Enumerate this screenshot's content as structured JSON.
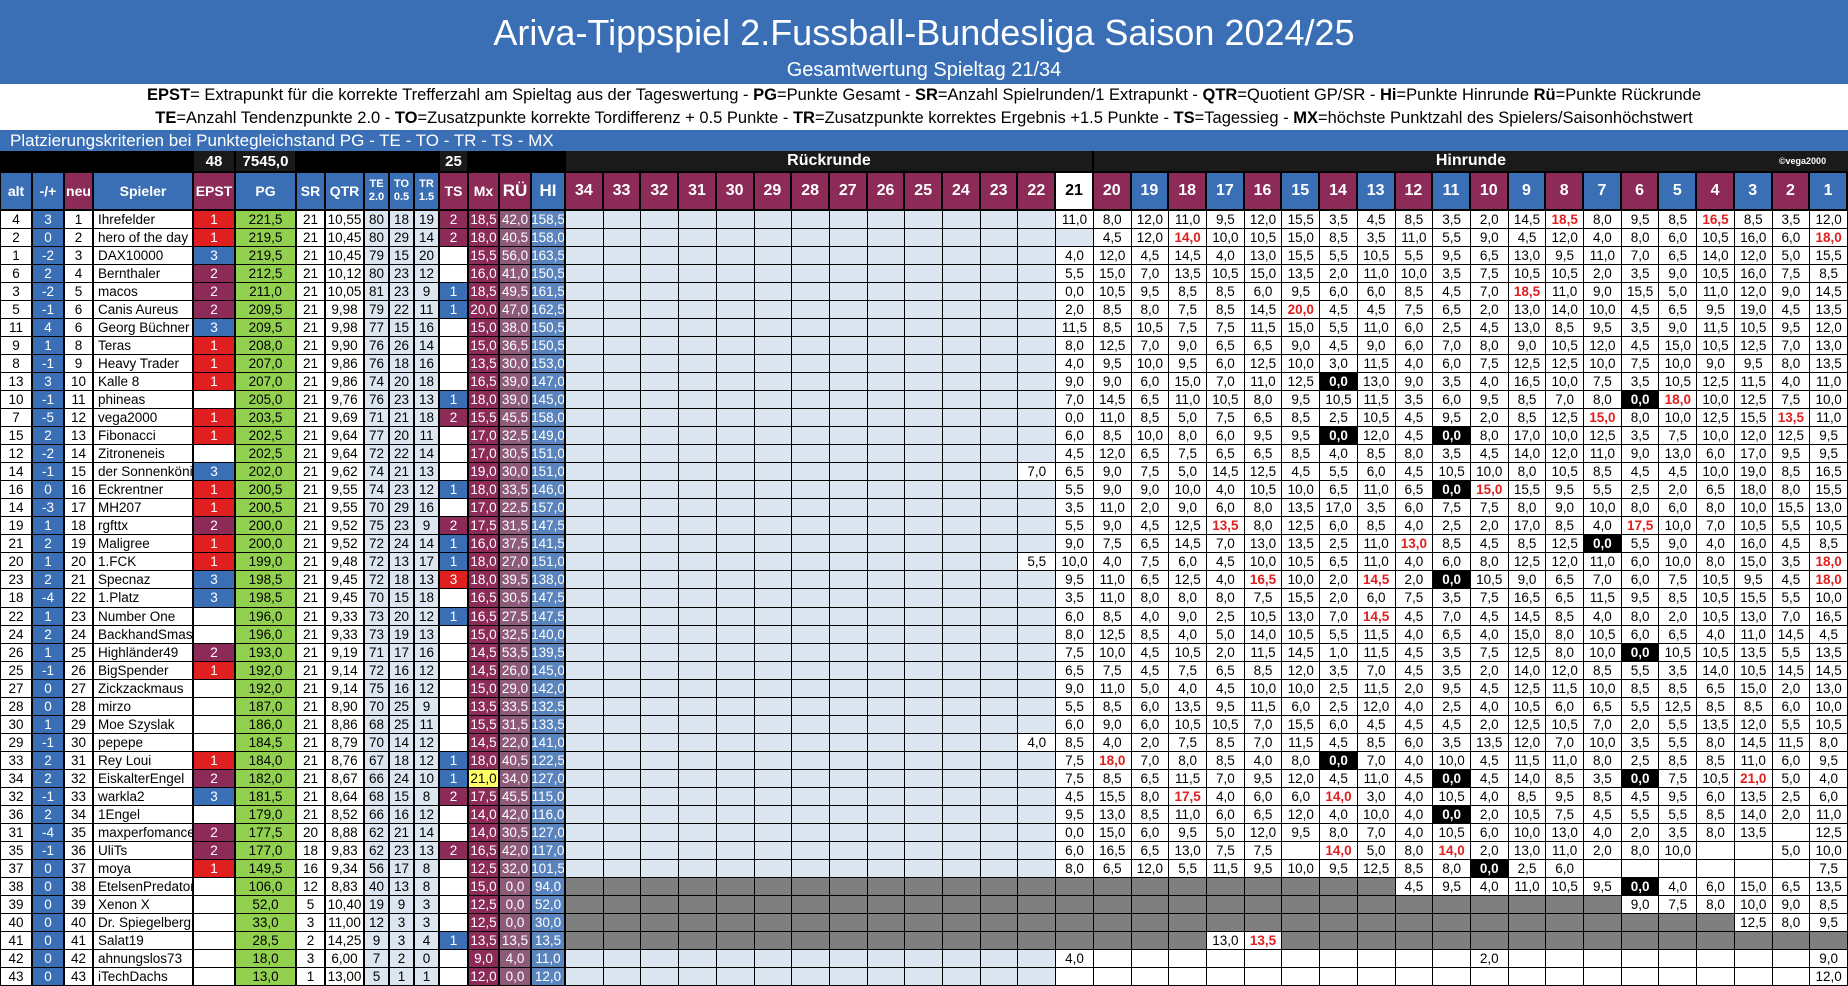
{
  "title": "Ariva-Tippspiel 2.Fussball-Bundesliga Saison 2024/25",
  "subtitle": "Gesamtwertung Spieltag 21/34",
  "legend_line1": [
    {
      "b": "EPST"
    },
    {
      "t": "= Extrapunkt für die korrekte Trefferzahl am Spieltag aus der Tageswertung - "
    },
    {
      "b": "PG"
    },
    {
      "t": "=Punkte Gesamt - "
    },
    {
      "b": "SR"
    },
    {
      "t": "=Anzahl Spielrunden/1 Extrapunkt - "
    },
    {
      "b": "QTR"
    },
    {
      "t": "=Quotient GP/SR - "
    },
    {
      "b": "Hi"
    },
    {
      "t": "=Punkte Hinrunde  "
    },
    {
      "b": "Rü"
    },
    {
      "t": "=Punkte Rückrunde"
    }
  ],
  "legend_line2": [
    {
      "b": "TE"
    },
    {
      "t": "=Anzahl Tendenzpunkte 2.0 - "
    },
    {
      "b": "TO"
    },
    {
      "t": "=Zusatzpunkte korrekte Tordifferenz + 0.5 Punkte - "
    },
    {
      "b": "TR"
    },
    {
      "t": "=Zusatzpunkte korrektes Ergebnis +1.5 Punkte - "
    },
    {
      "b": "TS"
    },
    {
      "t": "=Tagessieg - "
    },
    {
      "b": "MX"
    },
    {
      "t": "=höchste Punktzahl des Spielers/Saisonhöchstwert"
    }
  ],
  "criteria": "Platzierungskriterien bei Punktegleichstand  PG - TE - TO - TR - TS - MX",
  "totals": {
    "epst": "48",
    "pg": "7545,0",
    "ts": "25"
  },
  "section_rueckrunde": "Rückrunde",
  "section_hinrunde": "Hinrunde",
  "credit": "©vega2000",
  "headers": {
    "alt": "alt",
    "move": "-/+",
    "neu": "neu",
    "spieler": "Spieler",
    "epst": "EPST",
    "pg": "PG",
    "sr": "SR",
    "qtr": "QTR",
    "te": "TE",
    "te_sub": "2.0",
    "to": "TO",
    "to_sub": "0.5",
    "tr": "TR",
    "tr_sub": "1.5",
    "ts": "TS",
    "mx": "Mx",
    "ru": "RÜ",
    "hi": "HI"
  },
  "matchdays": [
    "34",
    "33",
    "32",
    "31",
    "30",
    "29",
    "28",
    "27",
    "26",
    "25",
    "24",
    "23",
    "22",
    "21",
    "20",
    "19",
    "18",
    "17",
    "16",
    "15",
    "14",
    "13",
    "12",
    "11",
    "10",
    "9",
    "8",
    "7",
    "6",
    "5",
    "4",
    "3",
    "2",
    "1"
  ],
  "colors": {
    "header_blue": "#3a6fb5",
    "maroon": "#8c2a58",
    "epst_red": "#e02020",
    "epst_purple": "#8c2a58",
    "epst_blue": "#3a6fb5",
    "pg_green": "#92d050",
    "mx_yellow": "#ffff66",
    "highlight_red": "#e02020",
    "zero_bg": "#000000",
    "empty_blue": "#dce6f1",
    "inactive_gray": "#7f7f7f"
  },
  "rows": [
    [
      "4",
      "3",
      "1",
      "Ihrefelder",
      "1",
      "221,5",
      "21",
      "10,55",
      "80",
      "18",
      "19",
      "2",
      "18,5",
      "42,0",
      "158,5",
      "11,0 8,0 12,0 11,0 9,5 12,0 15,5 3,5 4,5 8,5 3,5 2,0 14,5 18,5r 8,0 9,5 8,5 16,5r 8,5 3,5 12,0"
    ],
    [
      "2",
      "0",
      "2",
      "hero_of_the_day",
      "1",
      "219,5",
      "21",
      "10,45",
      "80",
      "29",
      "14",
      "2",
      "18,0",
      "40,5",
      "158,0",
      "4,5 12,0 14,0r 10,0 10,5 15,0 8,5 3,5 11,0 5,5 9,0 4,5 12,0 4,0 8,0 6,0 10,5 16,0 6,0 18,0r"
    ],
    [
      "1",
      "-2",
      "3",
      "DAX10000",
      "3",
      "219,5",
      "21",
      "10,45",
      "79",
      "15",
      "20",
      "",
      "15,5",
      "56,0",
      "163,5",
      "4,0 12,0 4,5 14,5 4,0 13,0 15,5 5,5 10,5 5,5 9,5 6,5 13,0 9,5 11,0 7,0 6,5 14,0 12,0 5,0 15,5"
    ],
    [
      "6",
      "2",
      "4",
      "Bernthaler",
      "2",
      "212,5",
      "21",
      "10,12",
      "80",
      "23",
      "12",
      "",
      "16,0",
      "41,0",
      "150,5",
      "5,5 15,0 7,0 13,5 10,5 15,0 13,5 2,0 11,0 10,0 3,5 7,5 10,5 10,5 2,0 3,5 9,0 10,5 16,0 7,5 8,5"
    ],
    [
      "3",
      "-2",
      "5",
      "macos",
      "2",
      "211,0",
      "21",
      "10,05",
      "81",
      "23",
      "9",
      "1",
      "18,5",
      "49,5",
      "161,5",
      "0,0 10,5 9,5 8,5 8,5 6,0 9,5 6,0 6,0 8,5 4,5 7,0 18,5r 11,0 9,0 15,5 5,0 11,0 12,0 9,0 14,5"
    ],
    [
      "5",
      "-1",
      "6",
      "Canis_Aureus",
      "2",
      "209,5",
      "21",
      "9,98",
      "79",
      "22",
      "11",
      "1",
      "20,0",
      "47,0",
      "162,5",
      "2,0 8,5 8,0 7,5 8,5 14,5 20,0r 4,5 4,5 7,5 6,5 2,0 13,0 14,0 10,0 4,5 6,5 9,5 19,0 4,5 13,5"
    ],
    [
      "11",
      "4",
      "6",
      "Georg_Büchner",
      "3",
      "209,5",
      "21",
      "9,98",
      "77",
      "15",
      "16",
      "",
      "15,0",
      "38,0",
      "150,5",
      "11,5 8,5 10,5 7,5 7,5 11,5 15,0 5,5 11,0 6,0 2,5 4,5 13,0 8,5 9,5 3,5 9,0 11,5 10,5 9,5 12,0"
    ],
    [
      "9",
      "1",
      "8",
      "Teras",
      "1",
      "208,0",
      "21",
      "9,90",
      "76",
      "26",
      "14",
      "",
      "15,0",
      "36,5",
      "150,5",
      "8,0 12,5 7,0 9,0 6,5 6,5 9,0 4,5 9,0 6,0 7,0 8,0 9,0 10,5 12,0 4,5 15,0 10,5 12,5 7,0 13,0"
    ],
    [
      "8",
      "-1",
      "9",
      "Heavy_Trader",
      "1",
      "207,0",
      "21",
      "9,86",
      "76",
      "18",
      "16",
      "",
      "13,5",
      "30,0",
      "153,0",
      "4,0 9,5 10,0 9,5 6,0 12,5 10,0 3,0 11,5 4,0 6,0 7,5 12,5 12,5 10,0 7,5 10,0 9,0 9,5 8,0 13,5"
    ],
    [
      "13",
      "3",
      "10",
      "Kalle_8",
      "1",
      "207,0",
      "21",
      "9,86",
      "74",
      "20",
      "18",
      "",
      "16,5",
      "39,0",
      "147,0",
      "9,0 9,0 6,0 15,0 7,0 11,0 12,5 0,0z 13,0 9,0 3,5 4,0 16,5 10,0 7,5 3,5 10,5 12,5 11,5 4,0 11,0"
    ],
    [
      "10",
      "-1",
      "11",
      "phineas",
      "",
      "205,0",
      "21",
      "9,76",
      "76",
      "23",
      "13",
      "1",
      "18,0",
      "39,0",
      "145,0",
      "7,0 14,5 6,5 11,0 10,5 8,0 9,5 10,5 11,5 3,5 6,0 9,5 8,5 7,0 8,0 0,0z 18,0r 10,0 12,5 7,5 10,0"
    ],
    [
      "7",
      "-5",
      "12",
      "vega2000",
      "1",
      "203,5",
      "21",
      "9,69",
      "71",
      "21",
      "18",
      "2",
      "15,5",
      "45,5",
      "158,0",
      "0,0 11,0 8,5 5,0 7,5 6,5 8,5 2,5 10,5 4,5 9,5 2,0 8,5 12,5 15,0r 8,0 10,0 12,5 15,5 13,5r 11,0"
    ],
    [
      "15",
      "2",
      "13",
      "Fibonacci",
      "1",
      "202,5",
      "21",
      "9,64",
      "77",
      "20",
      "11",
      "",
      "17,0",
      "32,5",
      "149,0",
      "6,0 8,5 10,0 8,0 6,0 9,5 9,5 0,0z 12,0 4,5 0,0z 8,0 17,0 10,0 12,5 3,5 7,5 10,0 12,0 12,5 9,5"
    ],
    [
      "12",
      "-2",
      "14",
      "Zitroneneis",
      "",
      "202,5",
      "21",
      "9,64",
      "72",
      "22",
      "14",
      "",
      "17,0",
      "30,5",
      "151,0",
      "4,5 12,0 6,5 7,5 6,5 6,5 8,5 4,0 8,5 8,0 3,5 4,5 14,0 12,0 11,0 9,0 13,0 6,0 17,0 9,5 9,5"
    ],
    [
      "14",
      "-1",
      "15",
      "der_Sonnenkönig",
      "3",
      "202,0",
      "21",
      "9,62",
      "74",
      "21",
      "13",
      "",
      "19,0",
      "30,0",
      "151,0",
      "7,0 6,5 9,0 7,5 5,0 14,5 12,5 4,5 5,5 6,0 4,5 10,5 10,0 8,0 10,5 8,5 4,5 4,5 10,0 19,0 8,5 16,5"
    ],
    [
      "16",
      "0",
      "16",
      "Eckrentner",
      "1",
      "200,5",
      "21",
      "9,55",
      "74",
      "23",
      "12",
      "1",
      "18,0",
      "33,5",
      "146,0",
      "5,5 9,0 9,0 10,0 4,0 10,5 10,0 6,5 11,0 6,5 0,0z 15,0r 15,5 9,5 5,5 2,5 2,0 6,5 18,0 8,0 15,5"
    ],
    [
      "14",
      "-3",
      "17",
      "MH207",
      "1",
      "200,5",
      "21",
      "9,55",
      "70",
      "29",
      "16",
      "",
      "17,0",
      "22,5",
      "157,0",
      "3,5 11,0 2,0 9,0 6,0 8,0 13,5 17,0 3,5 6,0 7,5 7,5 8,0 9,0 10,0 8,0 6,0 8,0 10,0 15,5 13,0"
    ],
    [
      "19",
      "1",
      "18",
      "rgfttx",
      "2",
      "200,0",
      "21",
      "9,52",
      "75",
      "23",
      "9",
      "2",
      "17,5",
      "31,5",
      "147,5",
      "5,5 9,0 4,5 12,5 13,5r 8,0 12,5 6,0 8,5 4,0 2,5 2,0 17,0 8,5 4,0 17,5r 10,0 7,0 10,5 5,5 10,5"
    ],
    [
      "21",
      "2",
      "19",
      "Maligree",
      "1",
      "200,0",
      "21",
      "9,52",
      "72",
      "24",
      "14",
      "1",
      "16,0",
      "37,5",
      "141,5",
      "9,0 7,5 6,5 14,5 7,0 13,0 13,5 2,5 11,0 13,0r 8,5 4,5 8,5 12,5 0,0z 5,5 9,0 4,0 16,0 4,5 8,5"
    ],
    [
      "20",
      "1",
      "20",
      "1.FCK",
      "1",
      "199,0",
      "21",
      "9,48",
      "72",
      "13",
      "17",
      "1",
      "18,0",
      "27,0",
      "151,0",
      "5,5 10,0 4,0 7,5 6,0 4,5 10,0 10,5 6,5 11,0 4,0 6,0 8,0 12,5 12,0 11,0 6,0 10,0 8,0 15,0 3,5 18,0r"
    ],
    [
      "23",
      "2",
      "21",
      "Specnaz",
      "3",
      "198,5",
      "21",
      "9,45",
      "72",
      "18",
      "13",
      "3",
      "18,0",
      "39,5",
      "138,0",
      "9,5 11,0 6,5 12,5 4,0 16,5r 10,0 2,0 14,5r 2,0 0,0z 10,5 9,0 6,5 7,0 6,0 7,5 10,5 9,5 4,5 18,0r"
    ],
    [
      "18",
      "-4",
      "22",
      "1.Platz",
      "3",
      "198,5",
      "21",
      "9,45",
      "70",
      "15",
      "18",
      "",
      "16,5",
      "30,5",
      "147,5",
      "3,5 11,0 8,0 8,0 8,0 7,5 15,5 2,0 6,0 7,5 3,5 7,5 16,5 6,5 11,5 9,5 8,5 10,5 15,5 5,5 10,0"
    ],
    [
      "22",
      "1",
      "23",
      "Number_One",
      "",
      "196,0",
      "21",
      "9,33",
      "73",
      "20",
      "12",
      "1",
      "16,5",
      "27,5",
      "147,5",
      "6,0 8,5 4,0 9,0 2,5 10,5 13,0 7,0 14,5r 4,5 7,0 4,5 14,5 8,5 4,0 8,0 2,0 10,5 13,0 7,0 16,5"
    ],
    [
      "24",
      "2",
      "24",
      "BackhandSmash",
      "",
      "196,0",
      "21",
      "9,33",
      "73",
      "19",
      "13",
      "",
      "15,0",
      "32,5",
      "140,0",
      "8,0 12,5 8,5 4,0 5,0 14,0 10,5 5,5 11,5 4,0 6,5 4,0 15,0 8,0 10,5 6,0 6,5 4,0 11,0 14,5 4,5"
    ],
    [
      "26",
      "1",
      "25",
      "Highländer49",
      "2",
      "193,0",
      "21",
      "9,19",
      "71",
      "17",
      "16",
      "",
      "14,5",
      "53,5",
      "139,5",
      "7,5 10,0 4,5 10,5 2,0 11,5 14,5 1,0 11,5 4,5 3,5 7,5 12,5 8,0 10,0 0,0z 10,5 10,5 13,5 5,5 13,5"
    ],
    [
      "25",
      "-1",
      "26",
      "BigSpender",
      "1",
      "192,0",
      "21",
      "9,14",
      "72",
      "16",
      "12",
      "",
      "14,5",
      "26,0",
      "145,0",
      "6,5 7,5 4,5 7,5 6,5 8,5 12,0 3,5 7,0 4,5 3,5 2,0 14,0 12,0 8,5 5,5 3,5 14,0 10,5 14,5 14,5"
    ],
    [
      "27",
      "0",
      "27",
      "Zickzackmaus",
      "",
      "192,0",
      "21",
      "9,14",
      "75",
      "16",
      "12",
      "",
      "15,0",
      "29,0",
      "142,0",
      "9,0 11,0 5,0 4,0 4,5 10,0 10,0 2,5 11,5 2,0 9,5 4,5 12,5 11,5 10,0 8,5 8,5 6,5 15,0 2,0 13,0"
    ],
    [
      "28",
      "0",
      "28",
      "mirzo",
      "",
      "187,0",
      "21",
      "8,90",
      "70",
      "25",
      "9",
      "",
      "13,5",
      "33,5",
      "132,5",
      "5,5 8,5 6,0 13,5 9,5 11,5 6,0 2,5 12,0 4,0 2,5 4,0 10,5 6,0 6,5 5,5 12,5 8,5 8,5 6,0 10,0"
    ],
    [
      "30",
      "1",
      "29",
      "Moe_Szyslak",
      "",
      "186,0",
      "21",
      "8,86",
      "68",
      "25",
      "11",
      "",
      "15,5",
      "31,5",
      "133,5",
      "6,0 9,0 6,0 10,5 10,5 7,0 15,5 6,0 4,5 4,5 4,5 2,0 12,5 10,5 7,0 2,0 5,5 13,5 12,0 5,5 10,5"
    ],
    [
      "29",
      "-1",
      "30",
      "pepepe",
      "",
      "184,5",
      "21",
      "8,79",
      "70",
      "14",
      "12",
      "",
      "14,5",
      "22,0",
      "141,0",
      "4,0 8,5 4,0 2,0 7,5 8,5 7,0 11,5 4,5 8,5 6,0 3,5 13,5 12,0 7,0 10,0 3,5 5,5 8,0 14,5 11,5 8,0"
    ],
    [
      "33",
      "2",
      "31",
      "Rey_Loui",
      "1",
      "184,0",
      "21",
      "8,76",
      "67",
      "18",
      "12",
      "1",
      "18,0",
      "40,5",
      "122,5",
      "7,5 18,0r 7,0 8,0 8,5 4,0 8,0 0,0z 7,0 4,0 10,0 4,5 11,5 11,0 8,0 2,5 8,5 8,5 11,0 6,0 9,5"
    ],
    [
      "34",
      "2",
      "32",
      "EiskalterEngel",
      "2",
      "182,0",
      "21",
      "8,67",
      "66",
      "24",
      "10",
      "1",
      "21,0",
      "34,0",
      "127,0",
      "7,5 8,5 6,5 11,5 7,0 9,5 12,0 4,5 11,0 4,5 0,0z 4,5 14,0 8,5 3,5 0,0z 7,5 10,5 21,0r 5,0 4,0"
    ],
    [
      "32",
      "-1",
      "33",
      "warkla2",
      "3",
      "181,5",
      "21",
      "8,64",
      "68",
      "15",
      "8",
      "2",
      "17,5",
      "45,5",
      "115,0",
      "4,5 15,5 8,0 17,5r 4,0 6,0 6,0 14,0r 3,0 4,0 10,5 4,0 8,5 9,5 8,5 4,5 9,5 6,0 13,5 2,5 6,0"
    ],
    [
      "36",
      "2",
      "34",
      "1Engel",
      "",
      "179,0",
      "21",
      "8,52",
      "66",
      "16",
      "12",
      "",
      "14,0",
      "42,0",
      "116,0",
      "9,5 13,0 8,5 11,0 6,0 6,5 12,0 4,0 10,0 4,0 0,0z 2,0 10,5 7,5 4,5 5,5 5,5 8,5 14,0 2,0 11,0"
    ],
    [
      "31",
      "-4",
      "35",
      "maxperfomance",
      "2",
      "177,5",
      "20",
      "8,88",
      "62",
      "21",
      "14",
      "",
      "14,0",
      "30,5",
      "127,0",
      "0,0 15,0 6,0 9,5 5,0 12,0 9,5 8,0 7,0 4,0 10,5 6,0 10,0 13,0 4,0 2,0 3,5 8,0 13,5 _ 12,5"
    ],
    [
      "35",
      "-1",
      "36",
      "UliTs",
      "2",
      "177,0",
      "18",
      "9,83",
      "62",
      "23",
      "13",
      "2",
      "16,5",
      "42,0",
      "117,0",
      "6,0 16,5 6,5 13,0 7,5 7,5 _ 14,0r 5,0 8,0 14,0r 2,0 13,0 11,0 2,0 8,0 10,0 _ _ 5,0 10,0"
    ],
    [
      "37",
      "0",
      "37",
      "moya",
      "1",
      "149,5",
      "16",
      "9,34",
      "56",
      "17",
      "8",
      "",
      "12,5",
      "32,0",
      "101,5",
      "8,0 6,5 12,0 5,5 11,5 9,5 10,0 9,5 12,5 8,5 8,0 0,0z 2,5 6,0 _ _ _ _ _ _ 7,5"
    ],
    [
      "38",
      "0",
      "38",
      "EtelsenPredator",
      "",
      "106,0",
      "12",
      "8,83",
      "40",
      "13",
      "8",
      "",
      "15,0",
      "0,0",
      "94,0",
      "g g g g g g g g g g 4,5 9,5 4,0 11,0 10,5 9,5 0,0z 4,0 6,0 15,0 6,5 13,5"
    ],
    [
      "39",
      "0",
      "39",
      "Xenon_X",
      "",
      "52,0",
      "5",
      "10,40",
      "19",
      "9",
      "3",
      "",
      "12,5",
      "0,0",
      "52,0",
      "g g g g g g g g g g g g g g g g 9,0 7,5 8,0 10,0 9,0 8,5"
    ],
    [
      "40",
      "0",
      "40",
      "Dr._Spiegelberg",
      "",
      "33,0",
      "3",
      "11,00",
      "12",
      "3",
      "3",
      "",
      "12,5",
      "0,0",
      "30,0",
      "g g g g g g g g g g g g g g g g g g 12,5 8,0 9,5"
    ],
    [
      "41",
      "0",
      "41",
      "Salat19",
      "",
      "28,5",
      "2",
      "14,25",
      "9",
      "3",
      "4",
      "1",
      "13,5",
      "13,5",
      "13,5",
      "g g g g 13,0 13,5r g g g g g g g g g g g g g g g"
    ],
    [
      "42",
      "0",
      "42",
      "ahnungslos73",
      "",
      "18,0",
      "3",
      "6,00",
      "7",
      "2",
      "0",
      "",
      "9,0",
      "4,0",
      "11,0",
      "4,0 _ _ _ _ _ _ _ _ _ _ 2,0 _ _ _ _ _ _ _ _ 9,0"
    ],
    [
      "43",
      "0",
      "43",
      "iTechDachs",
      "",
      "13,0",
      "1",
      "13,00",
      "5",
      "1",
      "1",
      "",
      "12,0",
      "0,0",
      "12,0",
      "_ _ _ _ _ _ _ _ _ _ _ _ _ _ _ _ _ _ _ _ 12,0"
    ]
  ]
}
